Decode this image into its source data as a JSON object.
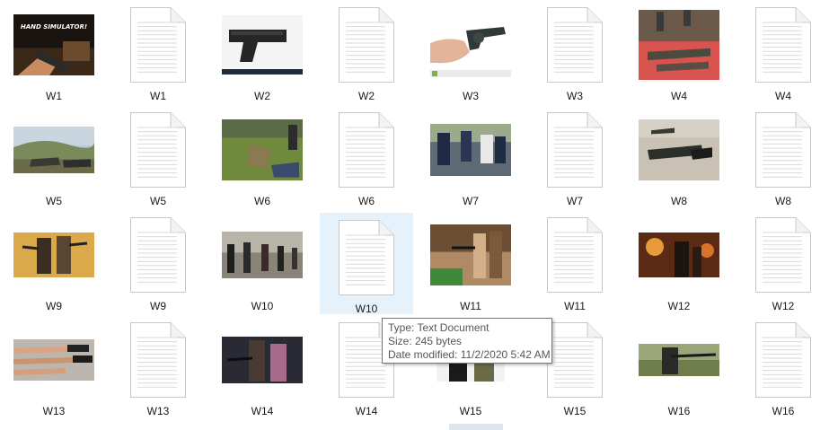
{
  "files": [
    {
      "label": "W1",
      "kind": "image",
      "scene": "game"
    },
    {
      "label": "W1",
      "kind": "document"
    },
    {
      "label": "W2",
      "kind": "image",
      "scene": "pistol"
    },
    {
      "label": "W2",
      "kind": "document"
    },
    {
      "label": "W3",
      "kind": "image",
      "scene": "revolver"
    },
    {
      "label": "W3",
      "kind": "document"
    },
    {
      "label": "W4",
      "kind": "image",
      "scene": "prone-red"
    },
    {
      "label": "W4",
      "kind": "document"
    },
    {
      "label": "W5",
      "kind": "image",
      "scene": "hills"
    },
    {
      "label": "W5",
      "kind": "document"
    },
    {
      "label": "W6",
      "kind": "image",
      "scene": "field"
    },
    {
      "label": "W6",
      "kind": "document"
    },
    {
      "label": "W7",
      "kind": "image",
      "scene": "range-group"
    },
    {
      "label": "W7",
      "kind": "document"
    },
    {
      "label": "W8",
      "kind": "image",
      "scene": "prone-sand"
    },
    {
      "label": "W8",
      "kind": "document"
    },
    {
      "label": "W9",
      "kind": "image",
      "scene": "movie-gold"
    },
    {
      "label": "W9",
      "kind": "document"
    },
    {
      "label": "W10",
      "kind": "image",
      "scene": "line-shooters"
    },
    {
      "label": "W10",
      "kind": "document",
      "selected": true
    },
    {
      "label": "W11",
      "kind": "image",
      "scene": "couple-range"
    },
    {
      "label": "W11",
      "kind": "document"
    },
    {
      "label": "W12",
      "kind": "image",
      "scene": "night-fire"
    },
    {
      "label": "W12",
      "kind": "document"
    },
    {
      "label": "W13",
      "kind": "image",
      "scene": "arms-row"
    },
    {
      "label": "W13",
      "kind": "document"
    },
    {
      "label": "W14",
      "kind": "image",
      "scene": "dark-duo"
    },
    {
      "label": "W14",
      "kind": "document"
    },
    {
      "label": "W15",
      "kind": "image",
      "scene": "soldiers"
    },
    {
      "label": "W15",
      "kind": "document"
    },
    {
      "label": "W16",
      "kind": "image",
      "scene": "rifle-green"
    },
    {
      "label": "W16",
      "kind": "document"
    }
  ],
  "tooltip": {
    "type": "Type: Text Document",
    "size": "Size: 245 bytes",
    "modified": "Date modified: 11/2/2020 5:42 AM"
  },
  "colors": {
    "selection": "#e5f1fb",
    "selection_border": "#cce8ff",
    "doc_fold": "#c8c8c8",
    "doc_lines": "#d9d9d9"
  }
}
